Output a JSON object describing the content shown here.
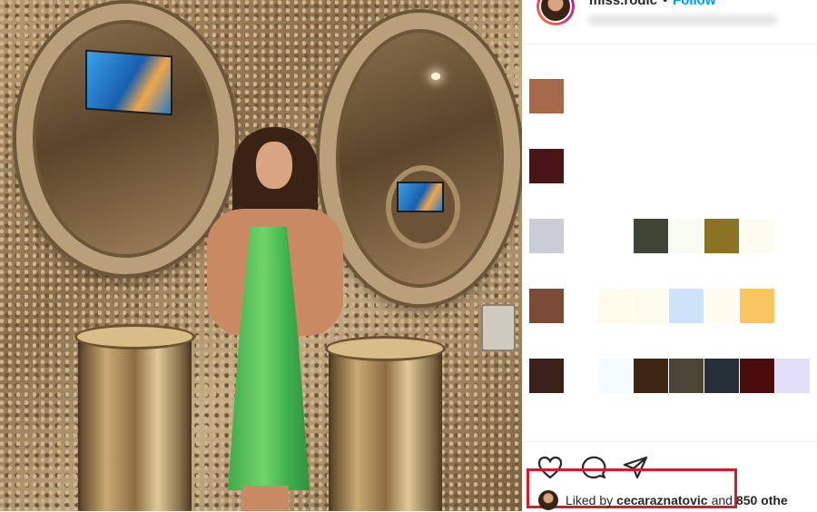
{
  "post": {
    "username": "miss.rodic",
    "separator": "•",
    "follow_label": "Follow"
  },
  "likes": {
    "prefix": "Liked by",
    "liker": "cecaraznatovic",
    "connector": "and",
    "others": "850 othe"
  },
  "colors": {
    "swatches_left": [
      "#a46a4a",
      "#4a1516",
      "#c9cdd6",
      "#7a4b37",
      "#3b2119"
    ],
    "swatches_row3": [
      "#3f4535",
      "#f8fbf2",
      "#8a7322",
      "#fdfcf0"
    ],
    "swatches_row4": [
      "#fdfbea",
      "#fcfced",
      "#cfe2fb",
      "#fdfcee",
      "#f8c560"
    ],
    "swatches_row5": [
      "#f4fbfd",
      "#3a2612",
      "#4a4535",
      "#262e38",
      "#4b0c0c",
      "#e4dff8"
    ],
    "highlight_box": "#d11f2a",
    "follow": "#0095f6"
  },
  "icons": [
    "heart-icon",
    "comment-icon",
    "share-icon"
  ]
}
